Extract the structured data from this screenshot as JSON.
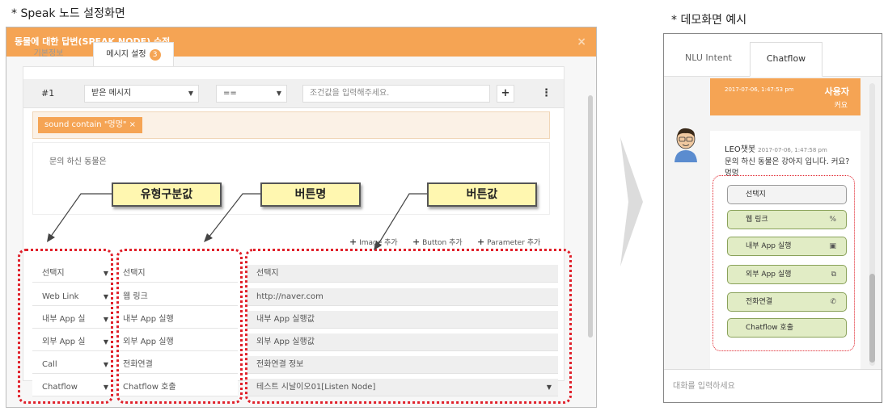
{
  "captions": {
    "left": "* Speak 노드 설정화면",
    "right": "* 데모화면 예시"
  },
  "modal": {
    "title": "동물에 대한 답변(SPEAK NODE) 수정",
    "close": "×",
    "tabs": {
      "basic": "기본정보",
      "message": "메시지 설정",
      "message_badge": "3"
    },
    "condition": {
      "index": "#1",
      "field": "받은 메시지",
      "operator": "==",
      "value_placeholder": "조건값을 입력해주세요.",
      "add": "+",
      "more": "⋮"
    },
    "tag": "sound contain \"멍멍\"  ×",
    "message_text": "문의 하신 동물은",
    "add_links": {
      "image": "Image 추가",
      "button": "Button 추가",
      "parameter": "Parameter 추가"
    },
    "buttons": [
      {
        "type": "선택지",
        "name": "선택지",
        "value": "선택지"
      },
      {
        "type": "Web Link",
        "name": "웹 링크",
        "value": "http://naver.com"
      },
      {
        "type": "내부 App 실",
        "name": "내부 App 실행",
        "value": "내부 App 실행값"
      },
      {
        "type": "외부 App 실",
        "name": "외부 App 실행",
        "value": "외부 App 실행값"
      },
      {
        "type": "Call",
        "name": "전화연결",
        "value": "전화연결 정보"
      },
      {
        "type": "Chatflow",
        "name": "Chatflow 호출",
        "value": "테스트 시날이오01[Listen Node]"
      }
    ]
  },
  "callouts": {
    "type": "유형구분값",
    "name": "버튼명",
    "value": "버튼값"
  },
  "demo": {
    "tabs": {
      "nlu": "NLU Intent",
      "chatflow": "Chatflow"
    },
    "user_msg": {
      "time": "2017-07-06, 1:47:53 pm",
      "name": "사용자",
      "text": "커요"
    },
    "bot_msg": {
      "name": "LEO챗봇",
      "time": "2017-07-06, 1:47:58 pm",
      "text": "문의 하신 동물은 강아지 입니다. 커요?멍멍"
    },
    "buttons": [
      {
        "label": "선택지",
        "icon": ""
      },
      {
        "label": "웹 링크",
        "icon": "%"
      },
      {
        "label": "내부 App 실행",
        "icon": "▣"
      },
      {
        "label": "외부 App 실행",
        "icon": "⧉"
      },
      {
        "label": "전화연결",
        "icon": "✆"
      },
      {
        "label": "Chatflow 호출",
        "icon": ""
      }
    ],
    "input_placeholder": "대화를 입력하세요"
  }
}
